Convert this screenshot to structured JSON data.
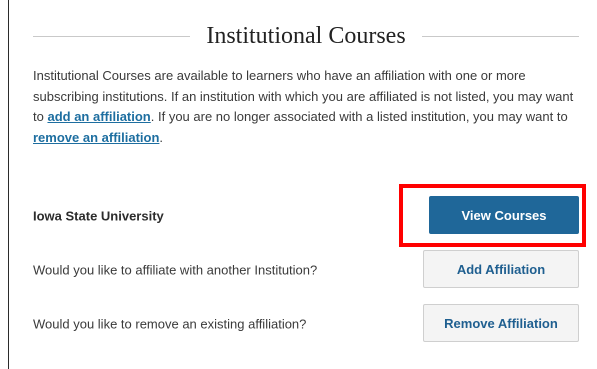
{
  "section": {
    "title": "Institutional Courses"
  },
  "intro": {
    "text_1": "Institutional Courses are available to learners who have an affiliation with one or more subscribing institutions. If an institution with which you are affiliated is not listed, you may want to ",
    "add_link": "add an affiliation",
    "text_2": ". If you are no longer associated with a listed institution, you may want to ",
    "remove_link": "remove an affiliation",
    "text_3": "."
  },
  "rows": {
    "institution": {
      "label": "Iowa State University",
      "button": "View Courses"
    },
    "add": {
      "label": "Would you like to affiliate with another Institution?",
      "button": "Add Affiliation"
    },
    "remove": {
      "label": "Would you like to remove an existing affiliation?",
      "button": "Remove Affiliation"
    }
  },
  "colors": {
    "primary_button": "#1f6799",
    "link": "#1d6ea0",
    "highlight": "#ff0000"
  }
}
